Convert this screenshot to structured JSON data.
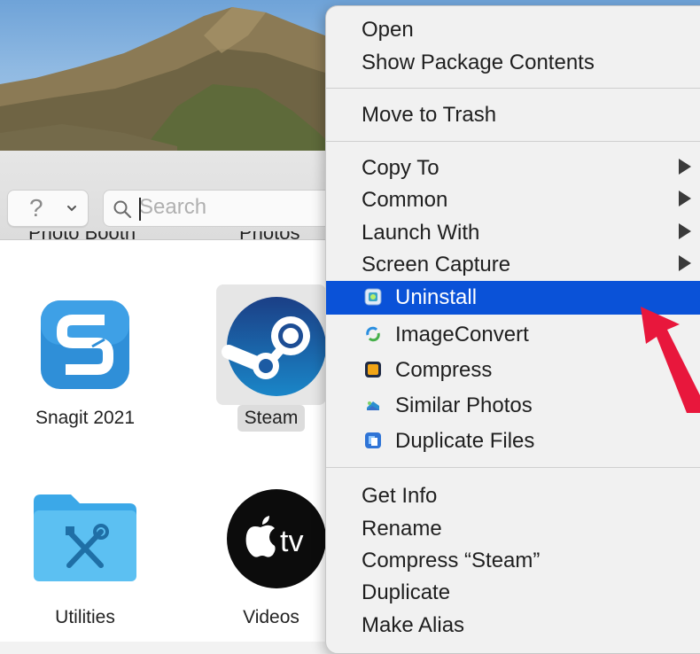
{
  "toolbar": {
    "help_glyph": "?",
    "search_placeholder": "Search"
  },
  "partial_row_labels": [
    "Photo Booth",
    "Photos"
  ],
  "apps": [
    {
      "name": "Snagit 2021",
      "icon": "snagit-icon"
    },
    {
      "name": "Steam",
      "icon": "steam-icon",
      "selected": true
    },
    {
      "name": "Utilities",
      "icon": "utilities-folder-icon"
    },
    {
      "name": "Videos",
      "icon": "apple-tv-icon"
    }
  ],
  "apple_tv_glyph": "tv",
  "context_menu": {
    "group1": [
      "Open",
      "Show Package Contents"
    ],
    "group2": [
      "Move to Trash"
    ],
    "group3": [
      {
        "label": "Copy To",
        "submenu": true
      },
      {
        "label": "Common",
        "submenu": true
      },
      {
        "label": "Launch With",
        "submenu": true
      },
      {
        "label": "Screen Capture",
        "submenu": true
      }
    ],
    "tools": [
      {
        "label": "Uninstall",
        "icon": "uninstall-icon",
        "highlighted": true
      },
      {
        "label": "ImageConvert",
        "icon": "imageconvert-icon"
      },
      {
        "label": "Compress",
        "icon": "compress-icon"
      },
      {
        "label": "Similar Photos",
        "icon": "similar-photos-icon"
      },
      {
        "label": "Duplicate Files",
        "icon": "duplicate-files-icon"
      }
    ],
    "group5": [
      "Get Info",
      "Rename",
      "Compress “Steam”",
      "Duplicate",
      "Make Alias"
    ]
  },
  "colors": {
    "highlight": "#0a52d8",
    "annotation_arrow": "#e8173c"
  }
}
